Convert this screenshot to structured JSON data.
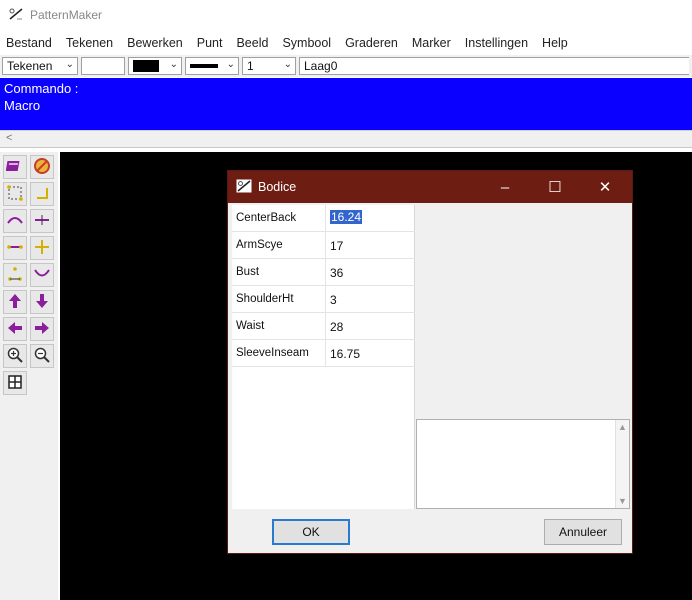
{
  "app": {
    "title": "PatternMaker",
    "icon": "patternmaker-logo-icon"
  },
  "menu": [
    "Bestand",
    "Tekenen",
    "Bewerken",
    "Punt",
    "Beeld",
    "Symbool",
    "Graderen",
    "Marker",
    "Instellingen",
    "Help"
  ],
  "toolbar": {
    "mode_value": "Tekenen",
    "color_value": "#000000",
    "line_width_value": "1",
    "layer_value": "Laag0"
  },
  "command_panel": {
    "line1": "Commando :",
    "line2": "Macro"
  },
  "tools": [
    "book-icon",
    "no-entry-icon",
    "select-points-icon",
    "corner-icon",
    "curve-icon",
    "tangent-icon",
    "line-icon",
    "cross-icon",
    "triangle-points-icon",
    "arc-icon",
    "arrow-up-icon",
    "arrow-down-icon",
    "arrow-left-icon",
    "arrow-right-icon",
    "zoom-in-icon",
    "zoom-out-icon",
    "grid-icon"
  ],
  "dialog": {
    "title": "Bodice",
    "params": [
      {
        "name": "CenterBack",
        "value": "16.24"
      },
      {
        "name": "ArmScye",
        "value": "17"
      },
      {
        "name": "Bust",
        "value": "36"
      },
      {
        "name": "ShoulderHt",
        "value": "3"
      },
      {
        "name": "Waist",
        "value": "28"
      },
      {
        "name": "SleeveInseam",
        "value": "16.75"
      }
    ],
    "ok_label": "OK",
    "cancel_label": "Annuleer"
  },
  "colors": {
    "command_bg": "#0a00ff",
    "dialog_title_bg": "#6e1d13",
    "canvas_bg": "#000000",
    "tool_purple": "#8b1e9b"
  }
}
